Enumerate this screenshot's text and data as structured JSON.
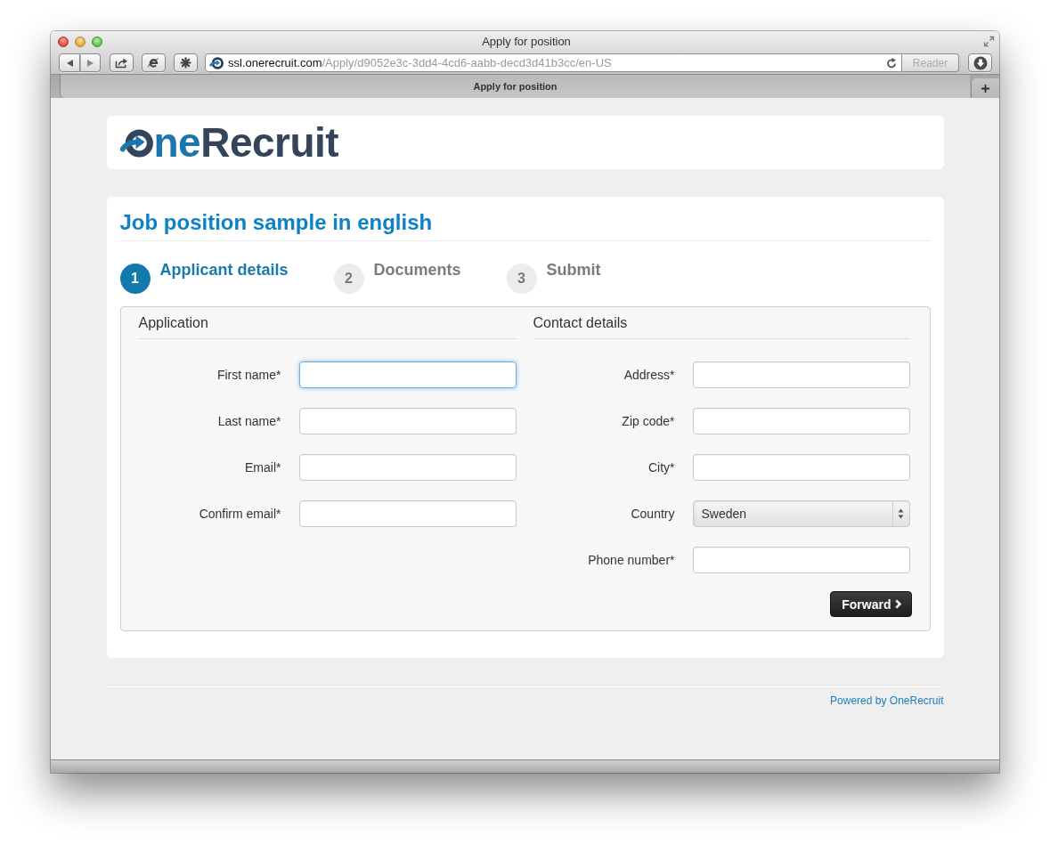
{
  "browser": {
    "title": "Apply for position",
    "address": {
      "host": "ssl.onerecruit.com",
      "path": "/Apply/d9052e3c-3dd4-4cd6-aabb-decd3d41b3cc/en-US"
    },
    "reader": {
      "label": "Reader",
      "disabled": true
    },
    "tabs": [
      {
        "label": "Apply for position",
        "selected": true
      }
    ]
  },
  "logo": {
    "accent": "ne",
    "main": "Recruit"
  },
  "job_title": "Job position sample in english",
  "steps": [
    {
      "number": "1",
      "label": "Applicant details",
      "selected": true
    },
    {
      "number": "2",
      "label": "Documents",
      "selected": false
    },
    {
      "number": "3",
      "label": "Submit",
      "selected": false
    }
  ],
  "form": {
    "sections": [
      {
        "title": "Application",
        "fields": [
          {
            "kind": "text",
            "label": "First name*",
            "focused": true
          },
          {
            "kind": "text",
            "label": "Last name*",
            "focused": false
          },
          {
            "kind": "text",
            "label": "Email*",
            "focused": false
          },
          {
            "kind": "text",
            "label": "Confirm email*",
            "focused": false
          }
        ]
      },
      {
        "title": "Contact details",
        "fields": [
          {
            "kind": "text",
            "label": "Address*",
            "focused": false
          },
          {
            "kind": "text",
            "label": "Zip code*",
            "focused": false
          },
          {
            "kind": "text",
            "label": "City*",
            "focused": false
          },
          {
            "kind": "select",
            "label": "Country",
            "value": "Sweden",
            "focused": false
          },
          {
            "kind": "text",
            "label": "Phone number*",
            "focused": false
          }
        ]
      }
    ],
    "submit": "Forward"
  },
  "footer": {
    "link": "Powered by OneRecruit"
  }
}
